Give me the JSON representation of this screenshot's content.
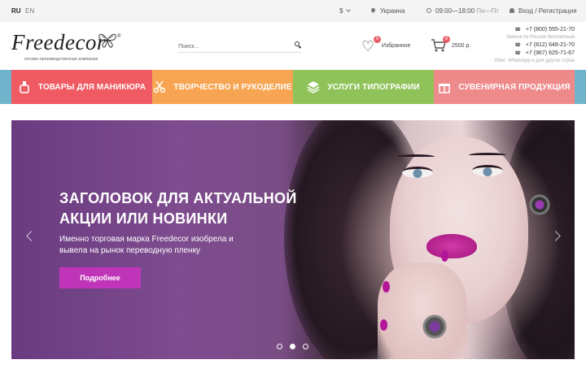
{
  "topbar": {
    "lang_ru": "RU",
    "lang_en": "EN",
    "currency": "$",
    "region": "Украина",
    "hours": "09:00—18:00",
    "days": "Пн—Пт",
    "login": "Вход / Регистрация"
  },
  "header": {
    "logo_text": "Freedecor",
    "logo_mark": "®",
    "logo_sub": "оптово-производственная компания",
    "search_placeholder": "Поиск...",
    "favorites_label": "Избранное",
    "favorites_count": "0",
    "cart_count": "0",
    "cart_sum": "2500 р.",
    "phones": [
      {
        "number": "+7 (800) 555-21-70",
        "note": "Звонок по России бесплатный"
      },
      {
        "number": "+7 (812) 648-21-70",
        "note": ""
      },
      {
        "number": "+7 (967) 625-71-67",
        "note": "Viber, WhatsApp и для других стран"
      }
    ]
  },
  "categories": [
    {
      "label": "ТОВАРЫ ДЛЯ МАНИКЮРА",
      "icon": "nail-polish-icon",
      "color": "#f05a63"
    },
    {
      "label": "ТВОРЧЕСТВО И РУКОДЕЛИЕ",
      "icon": "scissors-icon",
      "color": "#f7a552"
    },
    {
      "label": "УСЛУГИ ТИПОГРАФИИ",
      "icon": "layers-icon",
      "color": "#8fc35a"
    },
    {
      "label": "СУВЕНИРНАЯ ПРОДУКЦИЯ",
      "icon": "gift-icon",
      "color": "#ee8a8a"
    }
  ],
  "hero": {
    "title": "Заголовок для актуальной акции или новинки",
    "text": "Именно торговая марка Freedecor изобрела и вывела на рынок переводную пленку",
    "button": "Подробнее",
    "button_color": "#c034b9",
    "slides_count": 3,
    "active_slide": 2
  }
}
